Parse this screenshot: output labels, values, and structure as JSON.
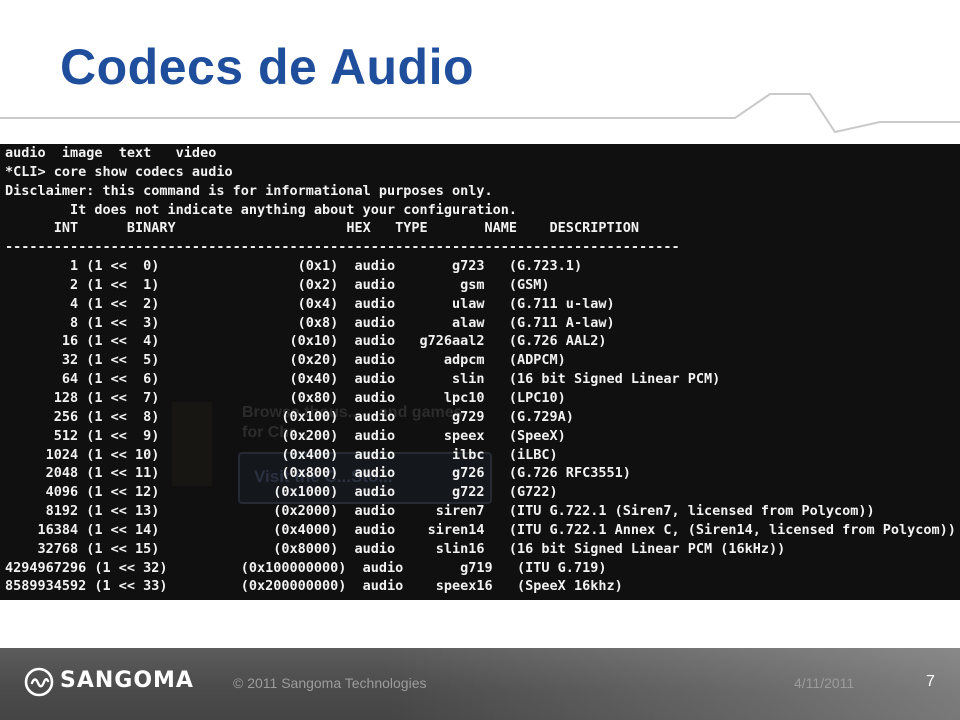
{
  "slide": {
    "title": "Codecs de Audio"
  },
  "terminal": {
    "text": "audio  image  text   video\n*CLI> core show codecs audio\nDisclaimer: this command is for informational purposes only.\n        It does not indicate anything about your configuration.\n      INT      BINARY                     HEX   TYPE       NAME    DESCRIPTION\n-----------------------------------------------------------------------------------\n        1 (1 <<  0)                 (0x1)  audio       g723   (G.723.1)\n        2 (1 <<  1)                 (0x2)  audio        gsm   (GSM)\n        4 (1 <<  2)                 (0x4)  audio       ulaw   (G.711 u-law)\n        8 (1 <<  3)                 (0x8)  audio       alaw   (G.711 A-law)\n       16 (1 <<  4)                (0x10)  audio   g726aal2   (G.726 AAL2)\n       32 (1 <<  5)                (0x20)  audio      adpcm   (ADPCM)\n       64 (1 <<  6)                (0x40)  audio       slin   (16 bit Signed Linear PCM)\n      128 (1 <<  7)                (0x80)  audio      lpc10   (LPC10)\n      256 (1 <<  8)               (0x100)  audio       g729   (G.729A)\n      512 (1 <<  9)               (0x200)  audio      speex   (SpeeX)\n     1024 (1 << 10)               (0x400)  audio       ilbc   (iLBC)\n     2048 (1 << 11)               (0x800)  audio       g726   (G.726 RFC3551)\n     4096 (1 << 12)              (0x1000)  audio       g722   (G722)\n     8192 (1 << 13)              (0x2000)  audio     siren7   (ITU G.722.1 (Siren7, licensed from Polycom))\n    16384 (1 << 14)              (0x4000)  audio    siren14   (ITU G.722.1 Annex C, (Siren14, licensed from Polycom))\n    32768 (1 << 15)              (0x8000)  audio     slin16   (16 bit Signed Linear PCM (16kHz))\n4294967296 (1 << 32)         (0x100000000)  audio       g719   (ITU G.719)\n8589934592 (1 << 33)         (0x200000000)  audio    speex16   (SpeeX 16khz)",
    "ghost_browse": "Browse thous... ...and games for Chr...",
    "ghost_button": "Visit the C...Sto...",
    "ghost_chevron": "‹"
  },
  "footer": {
    "logo_text": "SANGOMA",
    "copyright": "© 2011 Sangoma Technologies",
    "date": "4/11/2011",
    "page_number": "7"
  },
  "colors": {
    "title": "#1f4e9c",
    "terminal_bg": "#101010",
    "terminal_text": "#f2f2f2",
    "footer_bg": "#4a4a4a",
    "footer_muted_text": "#9c9c9c"
  }
}
